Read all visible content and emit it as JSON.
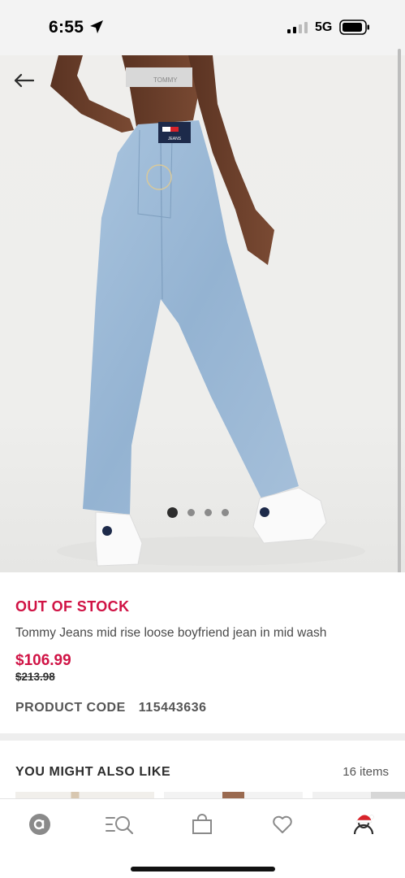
{
  "status_bar": {
    "time": "6:55",
    "network": "5G"
  },
  "product": {
    "stock_status": "OUT OF STOCK",
    "name": "Tommy Jeans mid rise loose boyfriend jean in mid wash",
    "price": "$106.99",
    "original_price": "$213.98",
    "code_label": "PRODUCT CODE",
    "code_value": "115443636",
    "brand_patch_top": "TOMMY",
    "brand_patch_bottom": "JEANS",
    "waistband_text": "TOMMY"
  },
  "carousel": {
    "total_images": 4,
    "active_index": 0
  },
  "recommendations": {
    "title": "YOU MIGHT ALSO LIKE",
    "count_label": "16 items"
  },
  "tabbar": {
    "items": [
      {
        "icon": "asos-logo-icon"
      },
      {
        "icon": "search-icon"
      },
      {
        "icon": "bag-icon"
      },
      {
        "icon": "heart-icon"
      },
      {
        "icon": "account-icon"
      }
    ]
  },
  "colors": {
    "accent": "#d01345",
    "text": "#2d2d2d",
    "denim": "#9cbad6"
  }
}
